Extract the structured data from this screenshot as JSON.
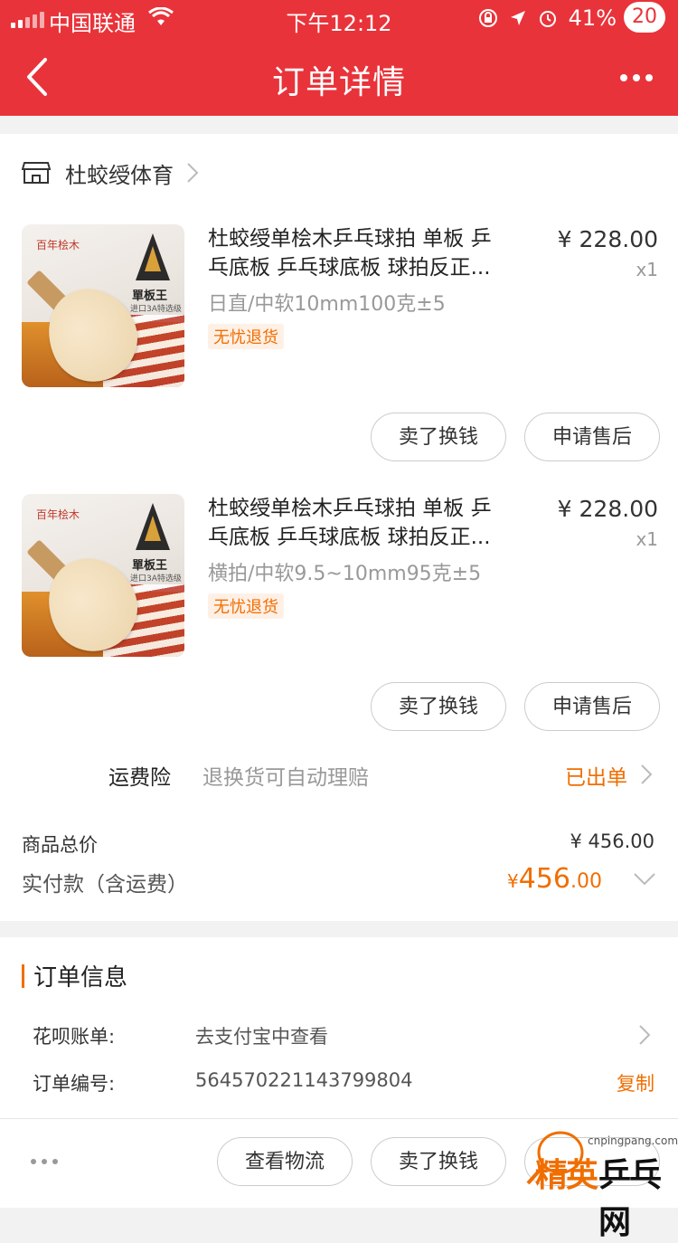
{
  "status_bar": {
    "carrier": "中国联通",
    "time": "下午12:12",
    "battery": "41%"
  },
  "header": {
    "title": "订单详情",
    "badge_count": "20"
  },
  "store": {
    "name": "杜蛟绶体育"
  },
  "items": [
    {
      "thumb_brand": "百年桧木",
      "thumb_model": "單板王",
      "thumb_grade": "进口3A特选级",
      "name_line1": "杜蛟绶单桧木乒乓球拍 单板 乒",
      "name_line2": "乓底板 乒乓球底板 球拍反正...",
      "sku": "日直/中软10mm100克±5",
      "tag": "无忧退货",
      "price": "¥ 228.00",
      "qty": "x1",
      "btn_resell": "卖了换钱",
      "btn_aftersale": "申请售后"
    },
    {
      "thumb_brand": "百年桧木",
      "thumb_model": "單板王",
      "thumb_grade": "进口3A特选级",
      "name_line1": "杜蛟绶单桧木乒乓球拍 单板 乒",
      "name_line2": "乓底板 乒乓球底板 球拍反正...",
      "sku": "横拍/中软9.5~10mm95克±5",
      "tag": "无忧退货",
      "price": "¥ 228.00",
      "qty": "x1",
      "btn_resell": "卖了换钱",
      "btn_aftersale": "申请售后"
    }
  ],
  "insurance": {
    "label": "运费险",
    "desc": "退换货可自动理赔",
    "status": "已出单"
  },
  "summary": {
    "goods_total_label": "商品总价",
    "goods_total": "¥ 456.00",
    "paid_label": "实付款（含运费）",
    "paid_currency": "¥",
    "paid_integer": "456",
    "paid_decimal": ".00"
  },
  "order_info": {
    "title": "订单信息",
    "huabei_label": "花呗账单:",
    "huabei_value": "去支付宝中查看",
    "order_no_label": "订单编号:",
    "order_no_value": "564570221143799804",
    "copy_label": "复制"
  },
  "bottom_bar": {
    "btn_logistics": "查看物流",
    "btn_resell": "卖了换钱"
  },
  "watermark": {
    "site": "cnpingpang.com",
    "text_a": "精英",
    "text_b": "乒乓网"
  },
  "colors": {
    "brand_red": "#e9333a",
    "accent_orange": "#f06e00"
  },
  "icons": [
    "signal-icon",
    "wifi-icon",
    "back-icon",
    "more-icon",
    "store-icon",
    "chevron-right-icon",
    "chevron-down-icon",
    "lock-rotation-icon",
    "location-icon",
    "alarm-icon",
    "battery-icon"
  ]
}
